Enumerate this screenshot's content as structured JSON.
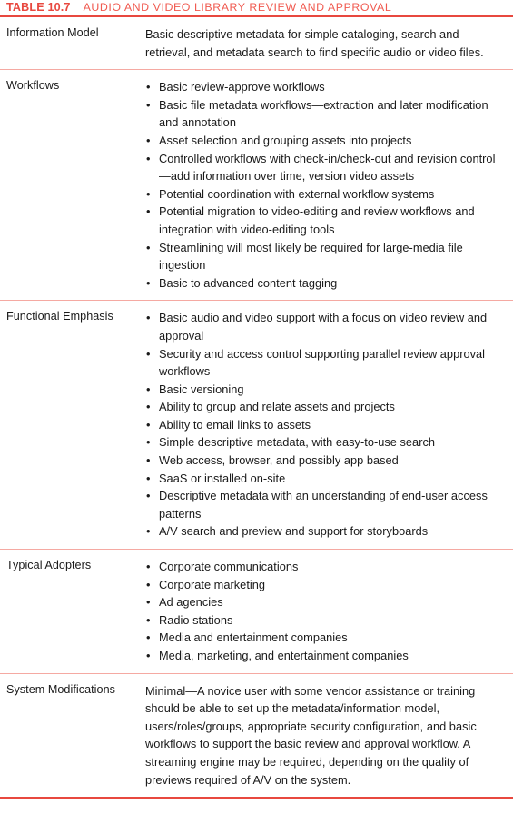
{
  "header": {
    "table_number": "TABLE 10.7",
    "caption": "AUDIO AND VIDEO LIBRARY REVIEW AND APPROVAL",
    "accent_color": "#E8483F",
    "divider_color": "#F5A9A2"
  },
  "rows": [
    {
      "label": "Information Model",
      "type": "paragraph",
      "text": "Basic descriptive metadata for simple cataloging, search and retrieval, and metadata search to find specific audio or video files."
    },
    {
      "label": "Workflows",
      "type": "bullets",
      "items": [
        "Basic review-approve workflows",
        "Basic file metadata workflows—extraction and later modification and annotation",
        "Asset selection and grouping assets into projects",
        "Controlled workflows with check-in/check-out and revision control—add information over time, version video assets",
        "Potential coordination with external workflow systems",
        "Potential migration to video-editing and review workflows and integration with video-editing tools",
        "Streamlining will most likely be required for large-media file ingestion",
        "Basic to advanced content tagging"
      ]
    },
    {
      "label": "Functional Emphasis",
      "type": "bullets",
      "items": [
        "Basic audio and video support with a focus on video review and approval",
        "Security and access control supporting parallel review approval workflows",
        "Basic versioning",
        "Ability to group and relate assets and projects",
        "Ability to email links to assets",
        "Simple descriptive metadata, with easy-to-use search",
        "Web access, browser, and possibly app based",
        "SaaS or installed on-site",
        "Descriptive metadata with an understanding of end-user access patterns",
        "A/V search and preview and support for storyboards"
      ]
    },
    {
      "label": "Typical Adopters",
      "type": "bullets",
      "items": [
        "Corporate communications",
        "Corporate marketing",
        "Ad agencies",
        "Radio stations",
        "Media and entertainment companies",
        "Media, marketing, and entertainment companies"
      ]
    },
    {
      "label": "System Modifications",
      "type": "paragraph",
      "text": "Minimal—A novice user with some vendor assistance or training should be able to set up the metadata/information model, users/roles/groups, appropriate security configuration, and basic workflows to support the basic review and approval workflow. A streaming engine may be required, depending on the quality of previews required of A/V on the system."
    }
  ],
  "bullet_glyph": "•"
}
